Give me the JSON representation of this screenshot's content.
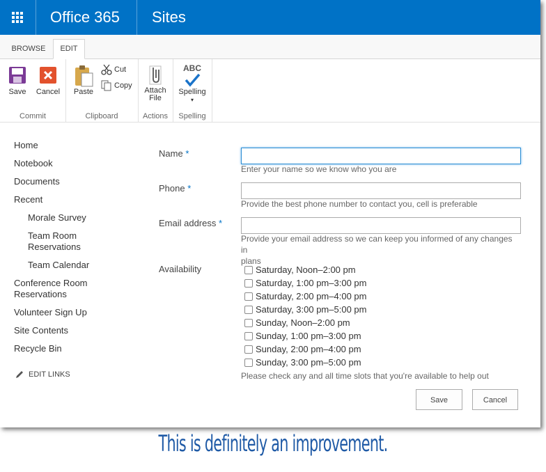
{
  "suite": {
    "brand": "Office 365",
    "app": "Sites"
  },
  "ribbon": {
    "tabs": [
      "BROWSE",
      "EDIT"
    ],
    "save": "Save",
    "cancel": "Cancel",
    "paste": "Paste",
    "cut": "Cut",
    "copy": "Copy",
    "attach_line1": "Attach",
    "attach_line2": "File",
    "spelling_abc": "ABC",
    "spelling": "Spelling",
    "groups": {
      "commit": "Commit",
      "clipboard": "Clipboard",
      "actions": "Actions",
      "spelling": "Spelling"
    }
  },
  "nav": {
    "home": "Home",
    "notebook": "Notebook",
    "documents": "Documents",
    "recent": "Recent",
    "morale_survey": "Morale Survey",
    "team_room_1": "Team Room",
    "team_room_2": "Reservations",
    "team_calendar": "Team Calendar",
    "conference_1": "Conference Room",
    "conference_2": "Reservations",
    "volunteer": "Volunteer Sign Up",
    "site_contents": "Site Contents",
    "recycle_bin": "Recycle Bin",
    "edit_links": "EDIT LINKS"
  },
  "form": {
    "name_label": "Name",
    "name_value": "",
    "name_hint": "Enter your name so we know who you are",
    "phone_label": "Phone",
    "phone_value": "",
    "phone_hint": "Provide the best phone number to contact you, cell is preferable",
    "email_label": "Email address",
    "email_value": "",
    "email_hint_1": "Provide your email address so we can keep you informed of any changes in",
    "email_hint_2": "plans",
    "required_mark": "*",
    "availability_label": "Availability",
    "slots": [
      "Saturday, Noon–2:00 pm",
      "Saturday, 1:00 pm–3:00 pm",
      "Saturday, 2:00 pm–4:00 pm",
      "Saturday, 3:00 pm–5:00 pm",
      "Sunday, Noon–2:00 pm",
      "Sunday, 1:00 pm–3:00 pm",
      "Sunday, 2:00 pm–4:00 pm",
      "Sunday, 3:00 pm–5:00 pm"
    ],
    "availability_hint": "Please check any and all time slots that you're available to help out",
    "save_button": "Save",
    "cancel_button": "Cancel"
  },
  "caption": "This is definitely an improvement.",
  "colors": {
    "suite_bar": "#0072c6",
    "required": "#0072c6",
    "caption": "#1f5aa6"
  }
}
